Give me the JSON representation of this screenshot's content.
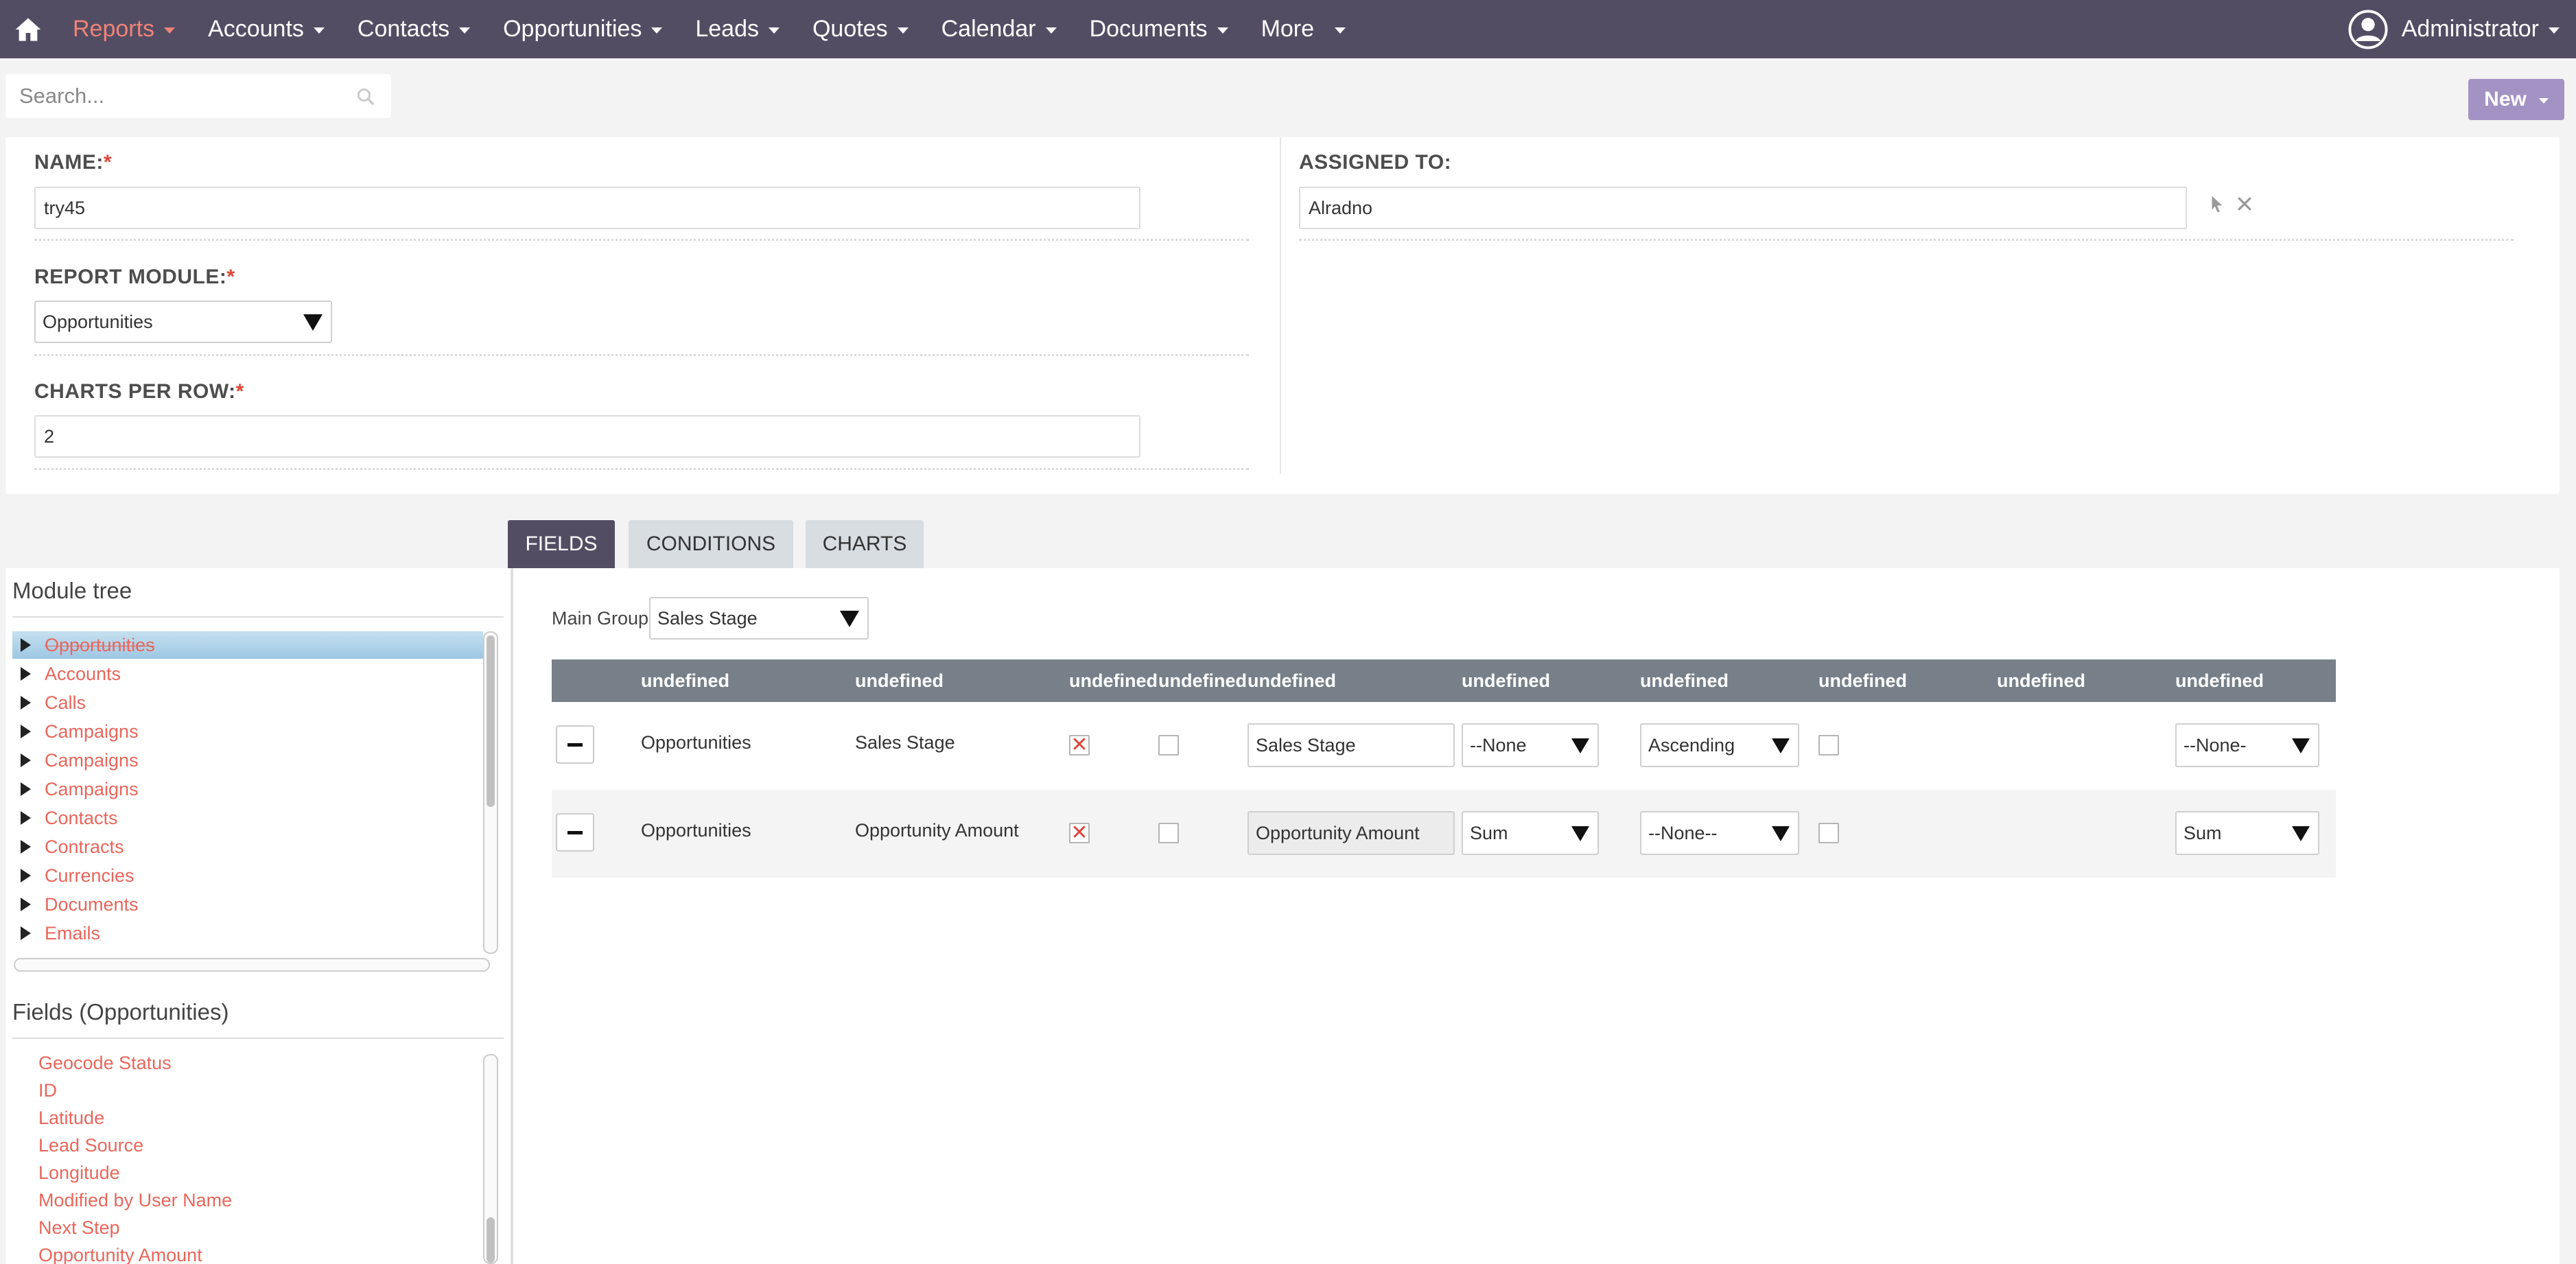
{
  "nav": {
    "items": [
      {
        "label": "Reports",
        "active": true
      },
      {
        "label": "Accounts"
      },
      {
        "label": "Contacts"
      },
      {
        "label": "Opportunities"
      },
      {
        "label": "Leads"
      },
      {
        "label": "Quotes"
      },
      {
        "label": "Calendar"
      },
      {
        "label": "Documents"
      },
      {
        "label": "More"
      }
    ],
    "user": "Administrator",
    "accent_color": "#f08377",
    "bar_color": "#534d64"
  },
  "search": {
    "placeholder": "Search..."
  },
  "actions": {
    "new_label": "New"
  },
  "form": {
    "name_label": "NAME:",
    "name_value": "try45",
    "assigned_label": "ASSIGNED TO:",
    "assigned_value": "Alradno",
    "module_label": "REPORT MODULE:",
    "module_value": "Opportunities",
    "charts_label": "CHARTS PER ROW:",
    "charts_value": "2",
    "required_mark": "*"
  },
  "tabs": [
    {
      "label": "FIELDS",
      "active": true
    },
    {
      "label": "CONDITIONS"
    },
    {
      "label": "CHARTS"
    }
  ],
  "module_tree": {
    "title": "Module tree",
    "items": [
      "Opportunities",
      "Accounts",
      "Calls",
      "Campaigns",
      "Campaigns",
      "Campaigns",
      "Contacts",
      "Contracts",
      "Currencies",
      "Documents",
      "Emails"
    ]
  },
  "fields_panel": {
    "title": "Fields (Opportunities)",
    "items": [
      "Geocode Status",
      "ID",
      "Latitude",
      "Lead Source",
      "Longitude",
      "Modified by User Name",
      "Next Step",
      "Opportunity Amount"
    ]
  },
  "main_group": {
    "label": "Main Group:",
    "value": "Sales Stage"
  },
  "table": {
    "headers": [
      "undefined",
      "undefined",
      "undefined",
      "undefined",
      "undefined",
      "undefined",
      "undefined",
      "undefined",
      "undefined",
      "undefined"
    ],
    "rows": [
      {
        "module": "Opportunities",
        "field": "Sales Stage",
        "display_checked": true,
        "label_value": "Sales Stage",
        "function": "--None",
        "sort": "Ascending",
        "group_fn": "--None-"
      },
      {
        "module": "Opportunities",
        "field": "Opportunity Amount",
        "display_checked": true,
        "label_value": "Opportunity Amount",
        "function": "Sum",
        "sort": "--None--",
        "group_fn": "Sum"
      }
    ]
  }
}
